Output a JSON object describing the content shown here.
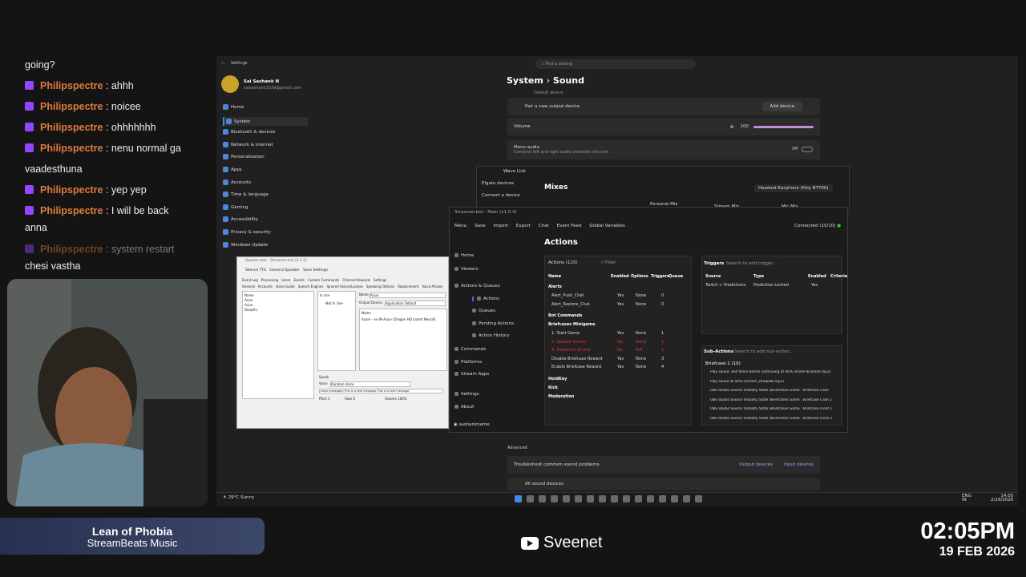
{
  "chat": {
    "messages": [
      {
        "text": "going?"
      },
      {
        "user": "Philipspectre",
        "text": "ahhh"
      },
      {
        "user": "Philipspectre",
        "text": "noicee"
      },
      {
        "user": "Philipspectre",
        "text": "ohhhhhhh"
      },
      {
        "user": "Philipspectre",
        "text": "nenu normal ga"
      },
      {
        "text": "vaadesthuna"
      },
      {
        "user": "Philipspectre",
        "text": "yep yep"
      },
      {
        "user": "Philipspectre",
        "text": "I will be back"
      },
      {
        "text": "anna"
      },
      {
        "user": "Philipspectre",
        "text": "system restart"
      },
      {
        "text": "chesi vastha"
      }
    ],
    "sep": " : "
  },
  "overlay": {
    "song": "Lean of Phobia",
    "artist": "StreamBeats Music",
    "channel": "Sveenet",
    "time": "02:05PM",
    "date": "19 FEB 2026"
  },
  "settings": {
    "title": "Settings",
    "search": "Find a setting",
    "user": "Sai Sashank N",
    "email": "saisashank3339@gmail.com",
    "nav": [
      "Home",
      "System",
      "Bluetooth & devices",
      "Network & internet",
      "Personalization",
      "Apps",
      "Accounts",
      "Time & language",
      "Gaming",
      "Accessibility",
      "Privacy & security",
      "Windows Update"
    ],
    "crumb1": "System",
    "crumb_sep": "›",
    "crumb2": "Sound",
    "default_device": "Default device",
    "pair": "Pair a new output device",
    "add_device": "Add device",
    "volume": "Volume",
    "volume_val": "100",
    "volume_level": 100,
    "mono": "Mono audio",
    "mono_desc": "Combine left and right audio channels into one",
    "mono_state": "Off",
    "advanced": "Advanced",
    "troubleshoot": "Troubleshoot common sound problems",
    "output_devices": "Output devices",
    "input_devices": "Input devices",
    "all_devices": "All sound devices"
  },
  "wavelink": {
    "title": "Wave Link",
    "elgato": "Elgato devices",
    "connect": "Connect a device",
    "mixes": "Mixes",
    "headset": "Headset Earphone (Poly BT700)",
    "tabs": [
      "Personal Mix",
      "Stream Mix",
      "Mic Mix"
    ]
  },
  "tts": {
    "title": "Speaker.bot - Streamer.bot (0.1.5)",
    "menu": [
      "Silence TTS",
      "General Speaker",
      "Save Settings"
    ],
    "tabs": [
      "Event Log",
      "Processing",
      "Users",
      "Events",
      "Custom Commands",
      "Channel Rewards",
      "Settings"
    ],
    "tabs2": [
      "General",
      "Accounts",
      "Voice Guide",
      "Speech Engines",
      "Ignored Voices/Locales",
      "Speaking Options",
      "Replacement",
      "Voice Aliases"
    ],
    "names": [
      "Name",
      "Arjun",
      "Arjun",
      "Deepthi"
    ],
    "in_use": "In Use",
    "not_in_use": "-Not In Use-",
    "alias_name": "Name",
    "alias_val": "Arjun",
    "output_device": "Output Device",
    "output_val": "Application Default",
    "voice": "Azure - en-IN-Arjun (Dragon HD Latest Neural)",
    "speak": "Speak",
    "speak_voice": "Voice",
    "speak_voice_val": "Random Voice",
    "test_msg": "<test message>This is a test message.This is a test message",
    "pitch": "Pitch",
    "pitch_val": "1",
    "rate": "Rate",
    "rate_val": "0",
    "volume": "Volume",
    "volume_val": "100%"
  },
  "sbot": {
    "title": "Streamer.bot - Main (v1.0.4)",
    "toolbar": [
      "Menu",
      "Save",
      "Import",
      "Export",
      "Chat",
      "Event Feed",
      "Global Variables"
    ],
    "connected": "Connected (10/10)",
    "nav": [
      "Home",
      "Viewers",
      "Actions & Queues",
      "Actions",
      "Queues",
      "Pending Actions",
      "Action History",
      "Commands",
      "Platforms",
      "Stream Apps",
      "Settings",
      "About"
    ],
    "user": "sashankname",
    "heading": "Actions",
    "actions_label": "Actions (115)",
    "filter": "Filter",
    "cols": [
      "Name",
      "Enabled",
      "Options",
      "Triggers",
      "Queue"
    ],
    "groups": [
      {
        "name": "Alerts",
        "rows": [
          [
            "Alert_Push_Chat",
            "Yes",
            "None",
            "0"
          ],
          [
            "Alert_Restore_Chat",
            "Yes",
            "None",
            "0"
          ]
        ]
      },
      {
        "name": "Bot Commands",
        "rows": []
      },
      {
        "name": "Briefcases Minigame",
        "rows": [
          [
            "1. Start Game",
            "Yes",
            "None",
            "1"
          ],
          [
            "2. Update Scores",
            "No",
            "None",
            "1"
          ],
          [
            "3. Prediction Ended",
            "No",
            "N/A",
            "1"
          ],
          [
            "Disable Briefcase Reward",
            "Yes",
            "None",
            "3"
          ],
          [
            "Enable Briefcase Reward",
            "Yes",
            "None",
            "4"
          ]
        ]
      },
      {
        "name": "HoldKey",
        "rows": []
      },
      {
        "name": "Kick",
        "rows": []
      },
      {
        "name": "Moderation",
        "rows": []
      }
    ],
    "triggers": "Triggers",
    "trig_search": "Search to add trigger...",
    "trig_cols": [
      "Source",
      "Type",
      "Enabled",
      "Criteria"
    ],
    "trig_row": [
      "Twitch > Predictions",
      "Prediction Locked",
      "Yes",
      ""
    ],
    "subactions": "Sub-Actions",
    "sub_search": "Search to add sub-action...",
    "sub_group": "Briefcase 1 (10)",
    "sub_items": [
      "Play sound, and finish before continuing at 40% (snare-drumroll.mp3)",
      "Play sound at 40% (correct_VsVqe9b.mp3)",
      "OBS Studio Source Visibility State (Briefcases Game : Briefcase Cash",
      "OBS Studio Source Visibility State (Briefcases Game : Briefcase Cash 2",
      "OBS Studio Source Visibility State (Briefcases Game : Briefcase Front 1",
      "OBS Studio Source Visibility State (Briefcases Game : Briefcase Front 2"
    ]
  },
  "taskbar": {
    "weather": "29°C",
    "weather_desc": "Sunny",
    "lang": "ENG",
    "lang2": "IN",
    "time": "14:05",
    "date": "2/19/2026"
  }
}
